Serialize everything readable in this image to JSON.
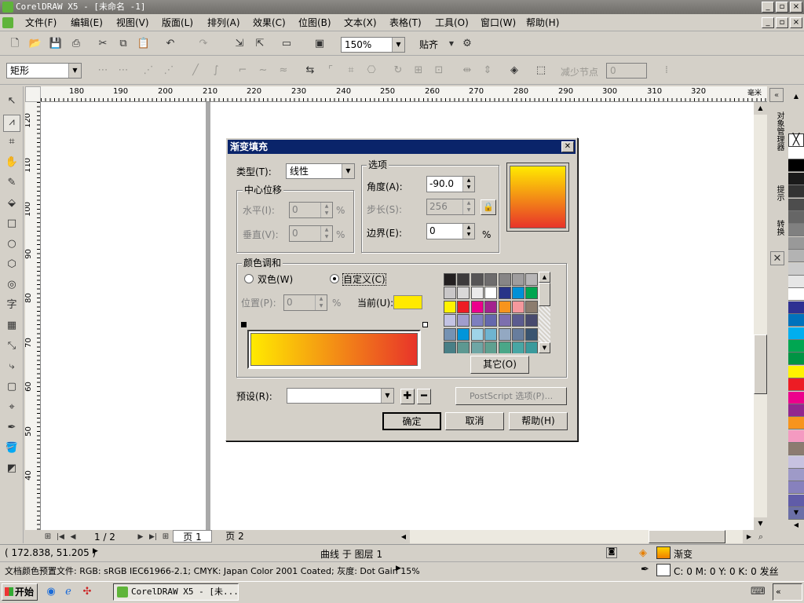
{
  "window": {
    "title": "CorelDRAW X5 - [未命名 -1]"
  },
  "menu": [
    "文件(F)",
    "编辑(E)",
    "视图(V)",
    "版面(L)",
    "排列(A)",
    "效果(C)",
    "位图(B)",
    "文本(X)",
    "表格(T)",
    "工具(O)",
    "窗口(W)",
    "帮助(H)"
  ],
  "toolbar": {
    "zoom": "150%",
    "snap_label": "贴齐"
  },
  "property_bar": {
    "object_type": "矩形",
    "reduce_nodes_label": "减少节点",
    "reduce_nodes_value": "0"
  },
  "ruler": {
    "top_ticks": [
      "180",
      "190",
      "200",
      "210",
      "220",
      "230",
      "240",
      "250",
      "260",
      "270",
      "280",
      "290",
      "300",
      "310",
      "320"
    ],
    "top_unit": "毫米",
    "left_ticks": [
      "120",
      "110",
      "100",
      "90",
      "80",
      "70",
      "60",
      "50",
      "40"
    ]
  },
  "dialog": {
    "title": "渐变填充",
    "type_label": "类型(T):",
    "type_value": "线性",
    "center_offset_label": "中心位移",
    "horizontal_label": "水平(I):",
    "horizontal_value": "0",
    "vertical_label": "垂直(V):",
    "vertical_value": "0",
    "percent": "%",
    "options_label": "选项",
    "angle_label": "角度(A):",
    "angle_value": "-90.0",
    "steps_label": "步长(S):",
    "steps_value": "256",
    "edge_label": "边界(E):",
    "edge_value": "0",
    "color_blend_label": "颜色调和",
    "two_color_label": "双色(W)",
    "custom_label": "自定义(C)",
    "position_label": "位置(P):",
    "position_value": "0",
    "current_label": "当前(U):",
    "current_color": "#ffea00",
    "gradient_start": "#ffea00",
    "gradient_end": "#e8342a",
    "others_button": "其它(O)",
    "preset_label": "预设(R):",
    "preset_value": "",
    "postscript_button": "PostScript 选项(P)...",
    "ok_button": "确定",
    "cancel_button": "取消",
    "help_button": "帮助(H)",
    "palette_colors": [
      "#231f20",
      "#3d3b3c",
      "#565455",
      "#6e6c6d",
      "#878586",
      "#9f9d9e",
      "#b8b6b7",
      "#c9c7c8",
      "#d9d8d8",
      "#ebeaea",
      "#ffffff",
      "#283488",
      "#0090d7",
      "#00a550",
      "#fff200",
      "#ed1c24",
      "#ec008c",
      "#a3238e",
      "#f7941d",
      "#f5989d",
      "#8c7c6e",
      "#c3c3e3",
      "#a09dcc",
      "#7e7fbf",
      "#6568ad",
      "#7d6fae",
      "#5b5b8f",
      "#484a6e",
      "#7592b3",
      "#0095da",
      "#9fd4e8",
      "#6fb4d0",
      "#93a8c2",
      "#677d9d",
      "#395470",
      "#497f86",
      "#5d9891",
      "#6fa6a5",
      "#5fa090",
      "#4aa788",
      "#48a6a4",
      "#3a9a9c"
    ]
  },
  "page_tabs": {
    "counter": "1 / 2",
    "tabs": [
      "页 1",
      "页 2"
    ]
  },
  "status": {
    "coords": "( 172.838, 51.205 )",
    "object_info": "曲线 于 图层 1",
    "fill_label": "渐变",
    "outline_label": "C: 0 M: 0 Y: 0 K: 0  发丝",
    "color_profile": "文档颜色预置文件: RGB: sRGB IEC61966-2.1; CMYK: Japan Color 2001 Coated; 灰度: Dot Gain 15%"
  },
  "dockers": {
    "object_manager": "对象管理器",
    "hints": "提示",
    "transform": "转换"
  },
  "right_palette": [
    "#ffffff",
    "#000000",
    "#1a1a1a",
    "#333333",
    "#4d4d4d",
    "#666666",
    "#808080",
    "#999999",
    "#b3b3b3",
    "#cccccc",
    "#e6e6e6",
    "#ffffff",
    "#2e3192",
    "#0072bc",
    "#00aeef",
    "#00a651",
    "#009444",
    "#fff200",
    "#ed1c24",
    "#ec008c",
    "#92278f",
    "#f7941d",
    "#f49ac1",
    "#8c7b70",
    "#c7c2e0",
    "#9e9ac8",
    "#8781bd",
    "#605ca8",
    "#6b6fa7"
  ],
  "taskbar": {
    "start": "开始",
    "task": "CorelDRAW X5 - [未..."
  }
}
